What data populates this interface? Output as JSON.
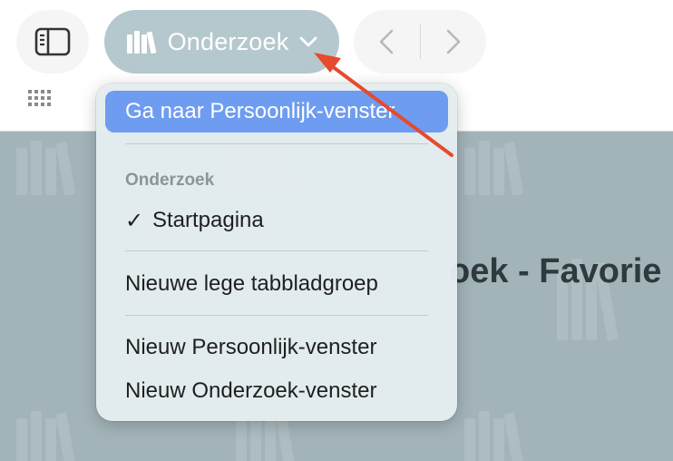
{
  "toolbar": {
    "group_button": {
      "label": "Onderzoek",
      "icon": "books-icon"
    },
    "sidebar_icon": "sidebar-icon",
    "back_icon": "chevron-left-icon",
    "forward_icon": "chevron-right-icon",
    "grid_icon": "grid-icon"
  },
  "menu": {
    "highlighted_item": "Ga naar Persoonlijk-venster",
    "section_header": "Onderzoek",
    "checked_item": {
      "check": "✓",
      "label": "Startpagina"
    },
    "items": [
      "Nieuwe lege tabbladgroep",
      "Nieuw Persoonlijk-venster",
      "Nieuw Onderzoek-venster"
    ]
  },
  "page": {
    "title_fragment": "oek - Favorie"
  },
  "colors": {
    "highlight": "#6e9cf0",
    "group_button": "#b5c8cd",
    "background": "#a3b4b9",
    "annotation_arrow": "#e64a2f"
  }
}
